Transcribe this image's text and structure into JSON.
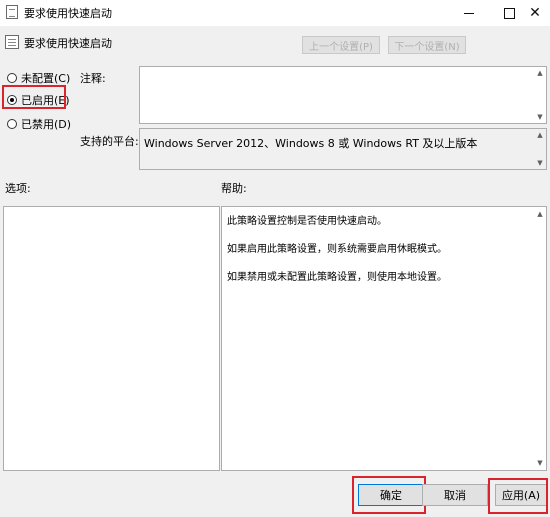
{
  "window": {
    "title": "要求使用快速启动",
    "close_glyph": "✕"
  },
  "header": {
    "title": "要求使用快速启动"
  },
  "nav": {
    "prev_label": "上一个设置(P)",
    "next_label": "下一个设置(N)"
  },
  "policy": {
    "options": [
      {
        "label": "未配置(C)",
        "selected": false
      },
      {
        "label": "已启用(E)",
        "selected": true
      },
      {
        "label": "已禁用(D)",
        "selected": false
      }
    ],
    "comment_label": "注释:",
    "comment_value": "",
    "platform_label": "支持的平台:",
    "platform_value": "Windows Server 2012、Windows 8 或 Windows RT 及以上版本"
  },
  "sections": {
    "options_label": "选项:",
    "help_label": "帮助:"
  },
  "help": {
    "lines": [
      "此策略设置控制是否使用快速启动。",
      "如果启用此策略设置，则系统需要启用休眠模式。",
      "如果禁用或未配置此策略设置，则使用本地设置。"
    ]
  },
  "buttons": {
    "ok": "确定",
    "cancel": "取消",
    "apply": "应用(A)"
  },
  "icons": {
    "scroll_up": "▲",
    "scroll_down": "▼"
  },
  "colors": {
    "highlight": "#d9232d",
    "focus": "#0078d7"
  }
}
